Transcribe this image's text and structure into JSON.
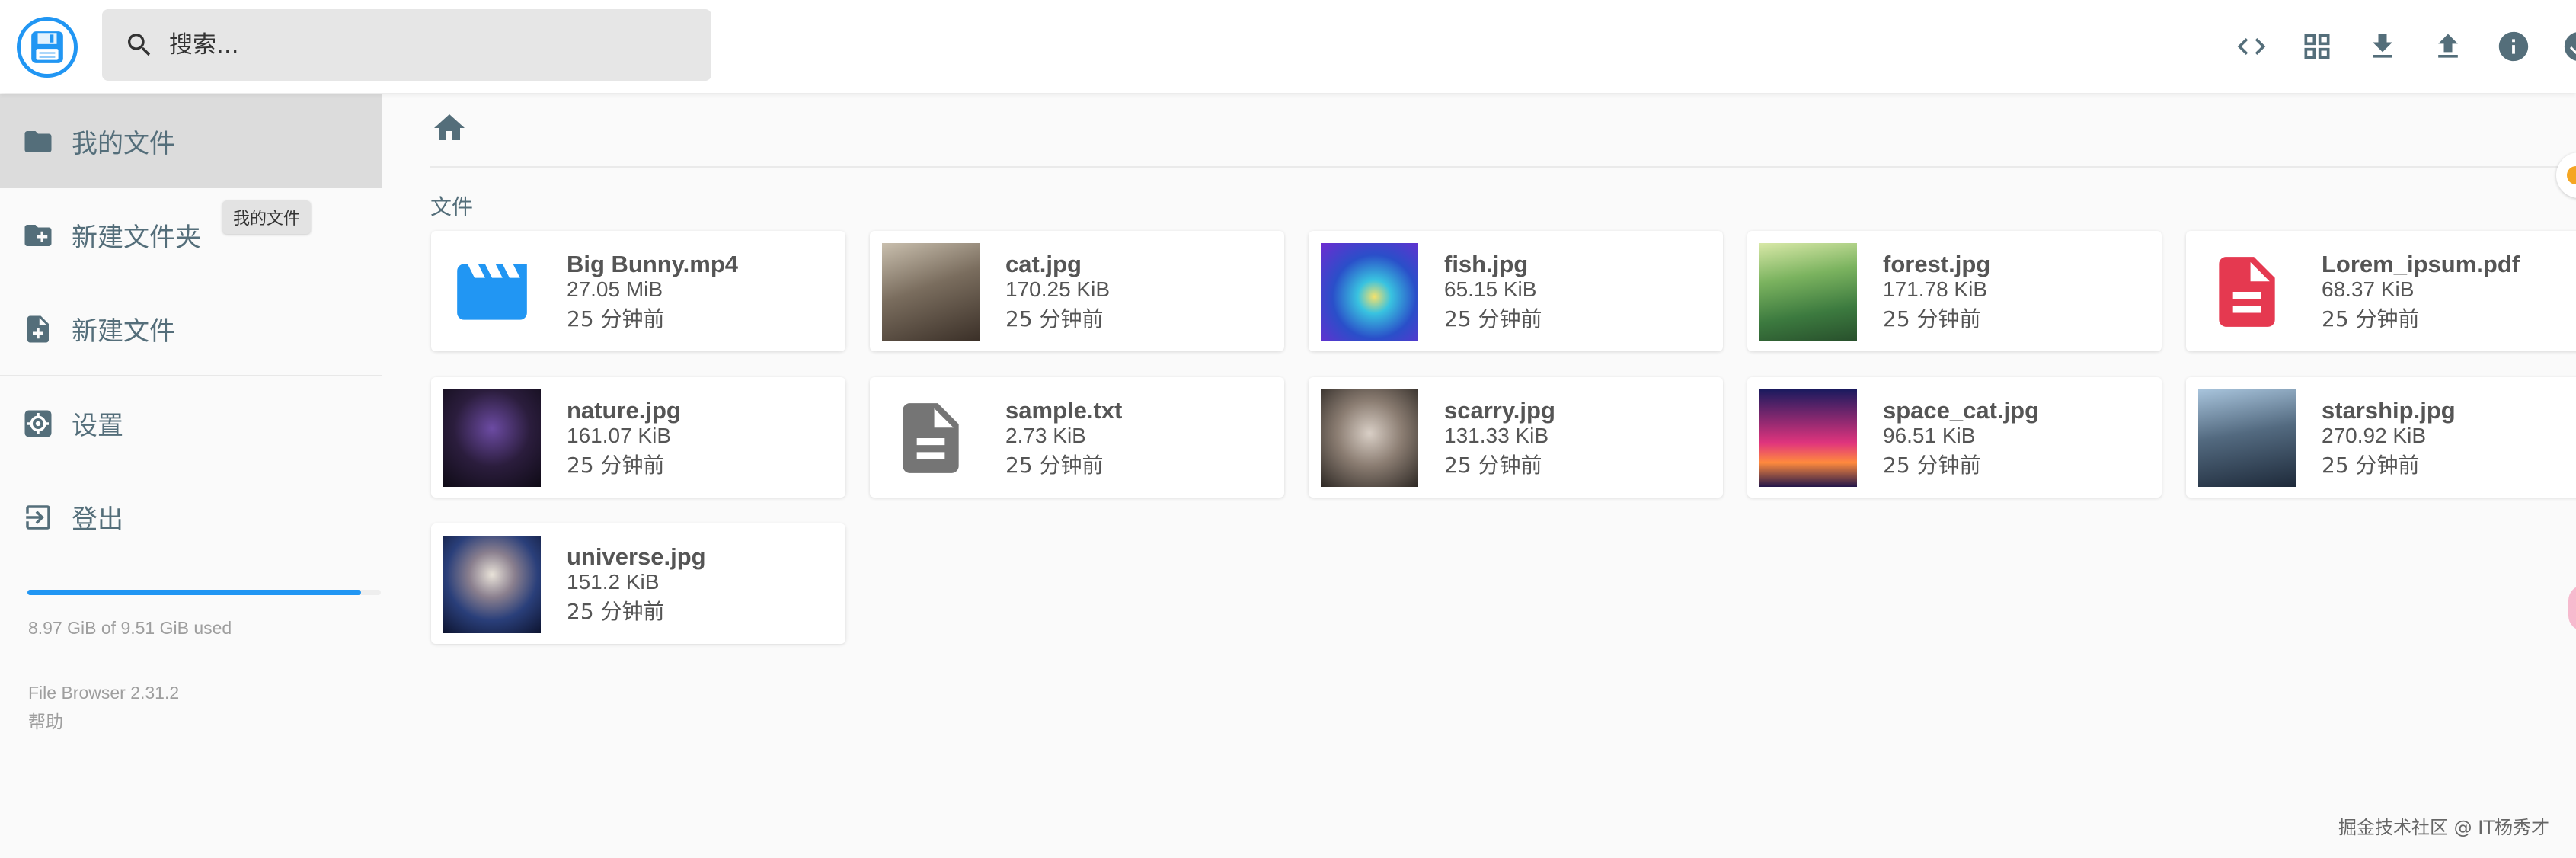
{
  "colors": {
    "accent": "#2196f3",
    "sidebar_active": "#dcdcdc",
    "text": "#546e7a",
    "pdf": "#e53950",
    "video": "#2196f3",
    "doc": "#757575"
  },
  "header": {
    "search_placeholder": "搜索...",
    "actions": [
      {
        "icon": "code-icon"
      },
      {
        "icon": "grid-view-icon"
      },
      {
        "icon": "download-icon"
      },
      {
        "icon": "upload-icon"
      },
      {
        "icon": "info-icon"
      },
      {
        "icon": "select-all-icon"
      }
    ]
  },
  "sidebar": {
    "items": [
      {
        "icon": "folder-icon",
        "label": "我的文件"
      },
      {
        "icon": "new-folder-icon",
        "label": "新建文件夹"
      },
      {
        "icon": "new-file-icon",
        "label": "新建文件"
      },
      {
        "icon": "settings-icon",
        "label": "设置"
      },
      {
        "icon": "logout-icon",
        "label": "登出"
      }
    ],
    "tooltip": "我的文件",
    "quota": {
      "text": "8.97 GiB of 9.51 GiB used",
      "used_fraction": 0.943
    },
    "version": "File Browser 2.31.2",
    "help": "帮助"
  },
  "main": {
    "section_title": "文件",
    "files": [
      {
        "name": "Big Bunny.mp4",
        "size": "27.05 MiB",
        "modified": "25 分钟前",
        "thumb": "video-icon"
      },
      {
        "name": "cat.jpg",
        "size": "170.25 KiB",
        "modified": "25 分钟前",
        "thumb": "image-cat"
      },
      {
        "name": "fish.jpg",
        "size": "65.15 KiB",
        "modified": "25 分钟前",
        "thumb": "image-fish"
      },
      {
        "name": "forest.jpg",
        "size": "171.78 KiB",
        "modified": "25 分钟前",
        "thumb": "image-forest"
      },
      {
        "name": "Lorem_ipsum.pdf",
        "size": "68.37 KiB",
        "modified": "25 分钟前",
        "thumb": "pdf-icon"
      },
      {
        "name": "nature.jpg",
        "size": "161.07 KiB",
        "modified": "25 分钟前",
        "thumb": "image-nature"
      },
      {
        "name": "sample.txt",
        "size": "2.73 KiB",
        "modified": "25 分钟前",
        "thumb": "text-file-icon"
      },
      {
        "name": "scarry.jpg",
        "size": "131.33 KiB",
        "modified": "25 分钟前",
        "thumb": "image-scarry"
      },
      {
        "name": "space_cat.jpg",
        "size": "96.51 KiB",
        "modified": "25 分钟前",
        "thumb": "image-space-cat"
      },
      {
        "name": "starship.jpg",
        "size": "270.92 KiB",
        "modified": "25 分钟前",
        "thumb": "image-starship"
      },
      {
        "name": "universe.jpg",
        "size": "151.2 KiB",
        "modified": "25 分钟前",
        "thumb": "image-universe"
      }
    ]
  },
  "watermark": "掘金技术社区 @ IT杨秀才"
}
